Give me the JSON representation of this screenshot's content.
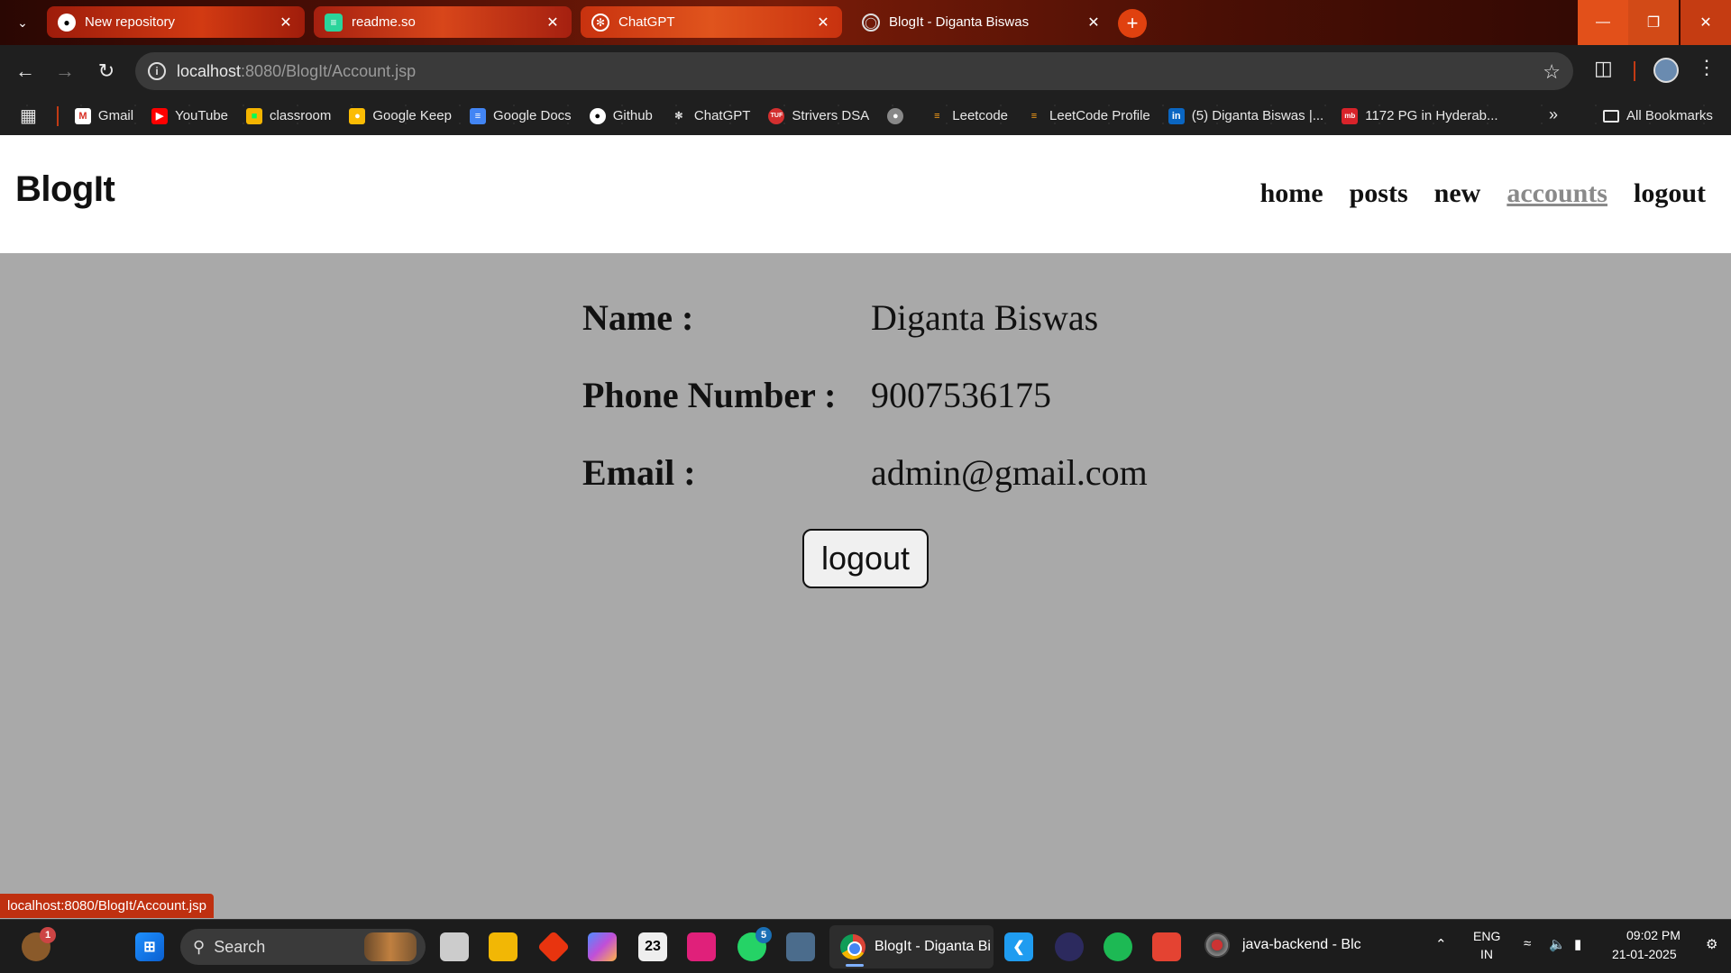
{
  "browser": {
    "tabs": [
      {
        "label": "New repository",
        "icon": "github-icon"
      },
      {
        "label": "readme.so",
        "icon": "readme-icon"
      },
      {
        "label": "ChatGPT",
        "icon": "chatgpt-icon"
      },
      {
        "label": "BlogIt - Diganta Biswas",
        "icon": "globe-icon"
      }
    ],
    "address": {
      "host": "localhost",
      "path": ":8080/BlogIt/Account.jsp"
    },
    "bookmarks": [
      {
        "label": "Gmail",
        "icon": "gmail-icon"
      },
      {
        "label": "YouTube",
        "icon": "youtube-icon"
      },
      {
        "label": "classroom",
        "icon": "classroom-icon"
      },
      {
        "label": "Google Keep",
        "icon": "keep-icon"
      },
      {
        "label": "Google Docs",
        "icon": "docs-icon"
      },
      {
        "label": "Github",
        "icon": "github-icon"
      },
      {
        "label": "ChatGPT",
        "icon": "chatgpt-icon"
      },
      {
        "label": "Strivers DSA",
        "icon": "tuf-icon"
      },
      {
        "label": "",
        "icon": "globe-icon"
      },
      {
        "label": "Leetcode",
        "icon": "leetcode-icon"
      },
      {
        "label": "LeetCode Profile",
        "icon": "leetcode-icon"
      },
      {
        "label": "(5) Diganta Biswas |...",
        "icon": "linkedin-icon"
      },
      {
        "label": "1172 PG in Hyderab...",
        "icon": "magicbricks-icon"
      }
    ],
    "all_bookmarks": "All Bookmarks",
    "status_url": "localhost:8080/BlogIt/Account.jsp"
  },
  "site": {
    "brand": "BlogIt",
    "nav": [
      "home",
      "posts",
      "new",
      "accounts",
      "logout"
    ],
    "active_nav": "accounts"
  },
  "account": {
    "name_label": "Name :",
    "name_value": "Diganta Biswas",
    "phone_label": "Phone Number :",
    "phone_value": "9007536175",
    "email_label": "Email :",
    "email_value": "admin@gmail.com",
    "logout_button": "logout"
  },
  "taskbar": {
    "search_placeholder": "Search",
    "widgets_badge": "1",
    "whatsapp_badge": "5",
    "calendar_day": "23",
    "chrome_task": "BlogIt - Diganta Bi",
    "java_task": "java-backend - Blc",
    "lang_top": "ENG",
    "lang_bottom": "IN",
    "time": "09:02 PM",
    "date": "21-01-2025"
  },
  "colors": {
    "page_bg": "#a9a9a9",
    "header_bg": "#ffffff",
    "active_nav": "#8a8a8a",
    "status_bg": "#bf3010"
  }
}
